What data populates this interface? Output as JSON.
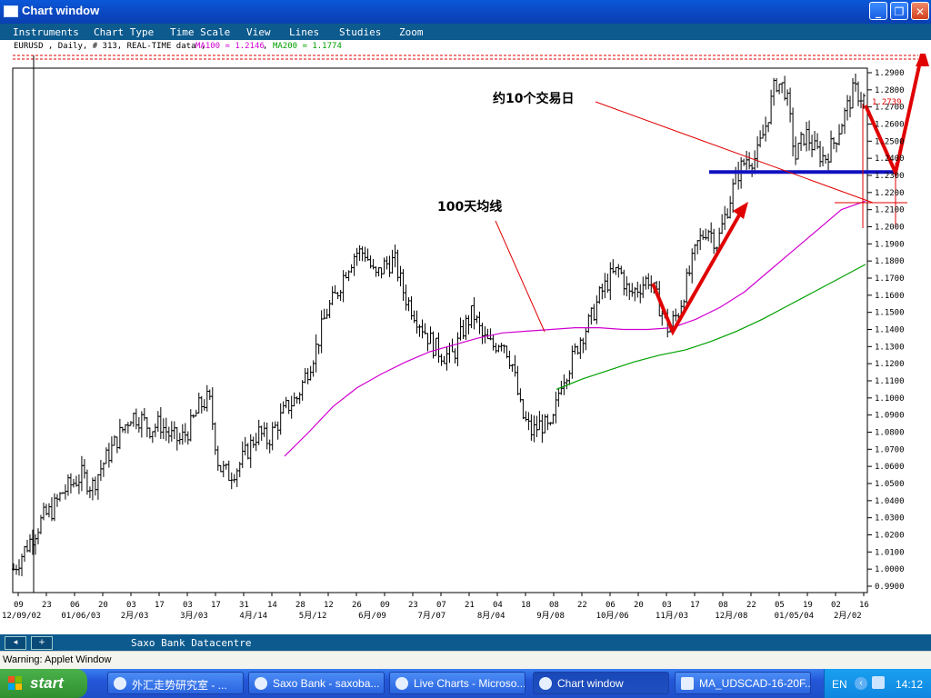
{
  "window": {
    "title": "Chart window",
    "buttons": {
      "minimize": "_",
      "maximize": "❐",
      "close": "✕"
    }
  },
  "menu": [
    "Instruments",
    "Chart Type",
    "Time Scale",
    "View",
    "Lines",
    "Studies",
    "Zoom"
  ],
  "infobar": {
    "prefix": "EURUSD , Daily, # 313, REAL-TIME data ,",
    "ma100": "MA100 = 1.2146",
    "sep": ",",
    "ma200": "MA200 = 1.1774"
  },
  "colors": {
    "ma100": "#d000d0",
    "ma200": "#00a000",
    "annotation": "#e00000",
    "support": "#1010c0",
    "price_tag": "#e00000"
  },
  "annotations": {
    "trading_days": "约10个交易日",
    "ma_label": "100天均线"
  },
  "price_tag": "1.2739",
  "chart_data": {
    "type": "ohlc",
    "instrument": "EURUSD",
    "interval": "Daily",
    "ylim": [
      0.98,
      1.3
    ],
    "y_ticks": [
      0.99,
      1.0,
      1.01,
      1.02,
      1.03,
      1.04,
      1.05,
      1.06,
      1.07,
      1.08,
      1.09,
      1.1,
      1.11,
      1.12,
      1.13,
      1.14,
      1.15,
      1.16,
      1.17,
      1.18,
      1.19,
      1.2,
      1.21,
      1.22,
      1.23,
      1.24,
      1.25,
      1.26,
      1.27,
      1.28,
      1.29
    ],
    "y_tick_labels": [
      "0.9900",
      "1.0000",
      "1.0100",
      "1.0200",
      "1.0300",
      "1.0400",
      "1.0500",
      "1.0600",
      "1.0700",
      "1.0800",
      "1.0900",
      "1.1000",
      "1.1100",
      "1.1200",
      "1.1300",
      "1.1400",
      "1.1500",
      "1.1600",
      "1.1700",
      "1.1800",
      "1.1900",
      "1.2000",
      "1.2100",
      "1.2200",
      "1.2300",
      "1.2400",
      "1.2500",
      "1.2600",
      "1.2700",
      "1.2800",
      "1.2900"
    ],
    "x_tick_top": [
      "09",
      "23",
      "06",
      "20",
      "03",
      "17",
      "03",
      "17",
      "31",
      "14",
      "28",
      "12",
      "26",
      "09",
      "23",
      "07",
      "21",
      "04",
      "18",
      "08",
      "22",
      "06",
      "20",
      "03",
      "17",
      "08",
      "22",
      "05",
      "19",
      "02",
      "16"
    ],
    "x_tick_bottom": [
      "12/09/02",
      "01/06/03",
      "2月/03",
      "3月/03",
      "4月/14",
      "5月/12",
      "6月/09",
      "7月/07",
      "8月/04",
      "9月/08",
      "10月/06",
      "11月/03",
      "12月/08",
      "01/05/04",
      "2月/02"
    ],
    "close_series": [
      1.0,
      1.01,
      1.02,
      1.03,
      1.035,
      1.045,
      1.05,
      1.055,
      1.048,
      1.06,
      1.07,
      1.08,
      1.09,
      1.088,
      1.082,
      1.085,
      1.078,
      1.075,
      1.082,
      1.095,
      1.1,
      1.06,
      1.055,
      1.06,
      1.07,
      1.08,
      1.075,
      1.085,
      1.095,
      1.1,
      1.115,
      1.13,
      1.15,
      1.16,
      1.175,
      1.185,
      1.185,
      1.17,
      1.178,
      1.18,
      1.16,
      1.15,
      1.14,
      1.13,
      1.125,
      1.125,
      1.14,
      1.15,
      1.135,
      1.13,
      1.135,
      1.12,
      1.09,
      1.08,
      1.085,
      1.08,
      1.11,
      1.12,
      1.135,
      1.145,
      1.16,
      1.17,
      1.175,
      1.16,
      1.165,
      1.17,
      1.155,
      1.14,
      1.15,
      1.17,
      1.19,
      1.2,
      1.19,
      1.21,
      1.23,
      1.24,
      1.24,
      1.26,
      1.285,
      1.28,
      1.24,
      1.255,
      1.245,
      1.24,
      1.25,
      1.265,
      1.28,
      1.275
    ],
    "ma100_series": [
      1.066,
      1.08,
      1.095,
      1.106,
      1.114,
      1.121,
      1.127,
      1.131,
      1.135,
      1.138,
      1.139,
      1.14,
      1.141,
      1.141,
      1.14,
      1.14,
      1.141,
      1.146,
      1.153,
      1.162,
      1.174,
      1.186,
      1.198,
      1.21,
      1.215
    ],
    "ma200_series": [
      1.105,
      1.111,
      1.116,
      1.121,
      1.125,
      1.128,
      1.133,
      1.139,
      1.146,
      1.154,
      1.162,
      1.17,
      1.178
    ],
    "support_level": 1.232,
    "arrows": [
      {
        "from": [
          1.168,
          "11月/03"
        ],
        "to": [
          1.14,
          "11月/03"
        ]
      },
      {
        "from": [
          1.14,
          "11月/03"
        ],
        "to": [
          1.214,
          "12月/08"
        ]
      },
      {
        "from": [
          1.27,
          "2月/02"
        ],
        "to": [
          1.232,
          "2月/02"
        ]
      },
      {
        "from": [
          1.232,
          "2月/02"
        ],
        "to": [
          1.31,
          "2月/02"
        ]
      }
    ]
  },
  "statusbar": {
    "text": "Saxo Bank Datacentre"
  },
  "warning": "Warning: Applet Window",
  "taskbar": {
    "start": "start",
    "tasks": [
      "外汇走势研究室 - ...",
      "Saxo Bank - saxoba...",
      "Live Charts - Microso...",
      "Chart window",
      "MA_UDSCAD-16-20F..."
    ],
    "active": 3,
    "lang": "EN",
    "clock": "14:12"
  }
}
